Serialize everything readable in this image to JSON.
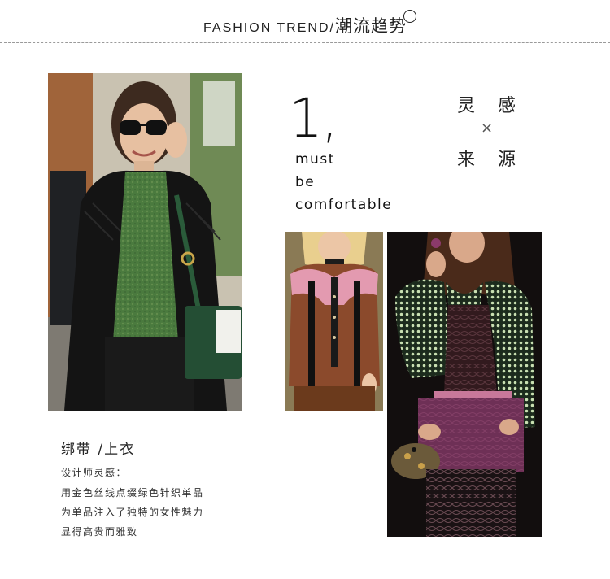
{
  "header": {
    "title_en": "FASHION TREND/",
    "title_zh": "潮流趋势"
  },
  "feature": {
    "number": "1,",
    "slogan": [
      "must",
      "be",
      "comfortable"
    ],
    "inspiration": {
      "top_left": "灵",
      "top_right": "感",
      "separator": "×",
      "bottom_left": "来",
      "bottom_right": "源"
    }
  },
  "caption": {
    "title": "绑带 /上衣",
    "lines": [
      "设计师灵感：",
      "用金色丝线点缀绿色针织单品",
      "为单品注入了独特的女性魅力",
      "显得高贵而雅致"
    ]
  },
  "colors": {
    "text": "#222222",
    "divider": "#9a9a9a",
    "background": "#ffffff"
  }
}
